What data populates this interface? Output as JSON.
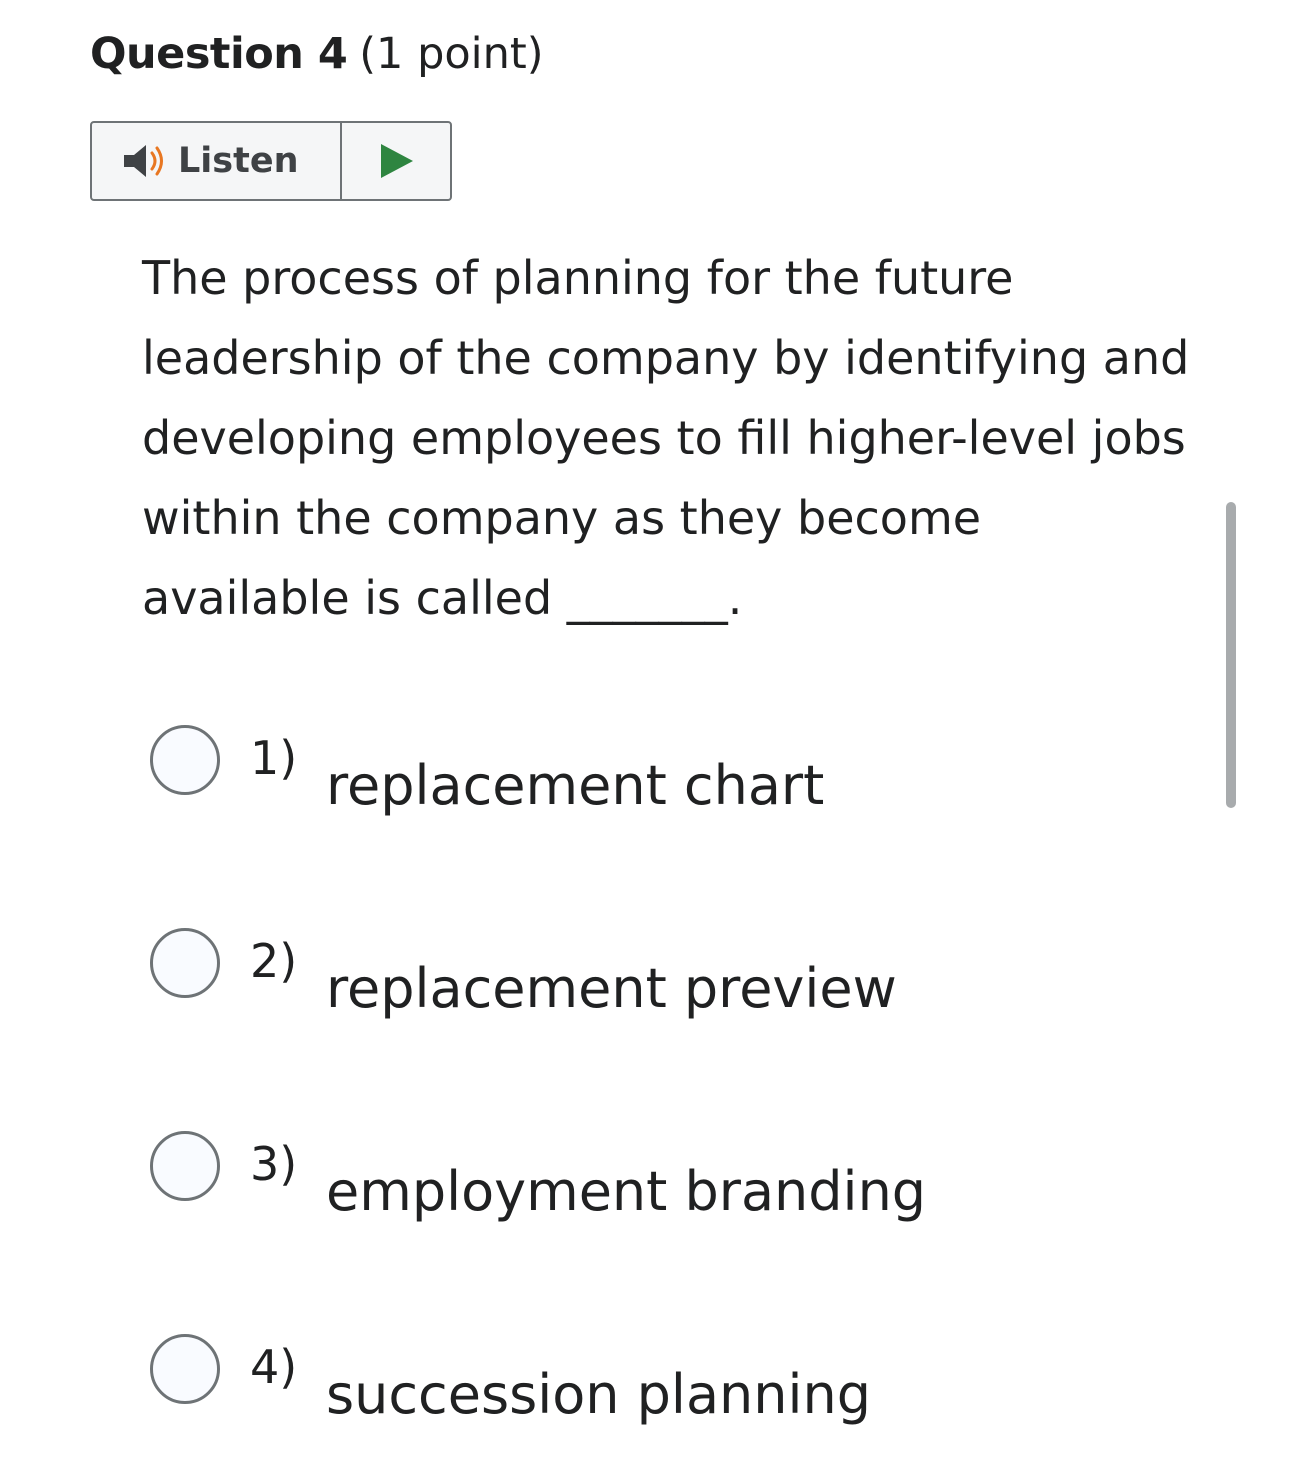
{
  "question": {
    "label": "Question 4",
    "points": "(1 point)",
    "text": "The process of planning for the future leadership of the company by identifying and developing employees to fill higher-level jobs within the company as they become available is called _______."
  },
  "listen": {
    "label": "Listen",
    "icon": "speaker-icon",
    "play_icon": "play-icon",
    "play_color": "#2e8540",
    "speaker_wave_color": "#e87722"
  },
  "choices": [
    {
      "number": "1)",
      "text": "replacement chart"
    },
    {
      "number": "2)",
      "text": "replacement preview"
    },
    {
      "number": "3)",
      "text": "employment branding"
    },
    {
      "number": "4)",
      "text": "succession planning"
    }
  ]
}
